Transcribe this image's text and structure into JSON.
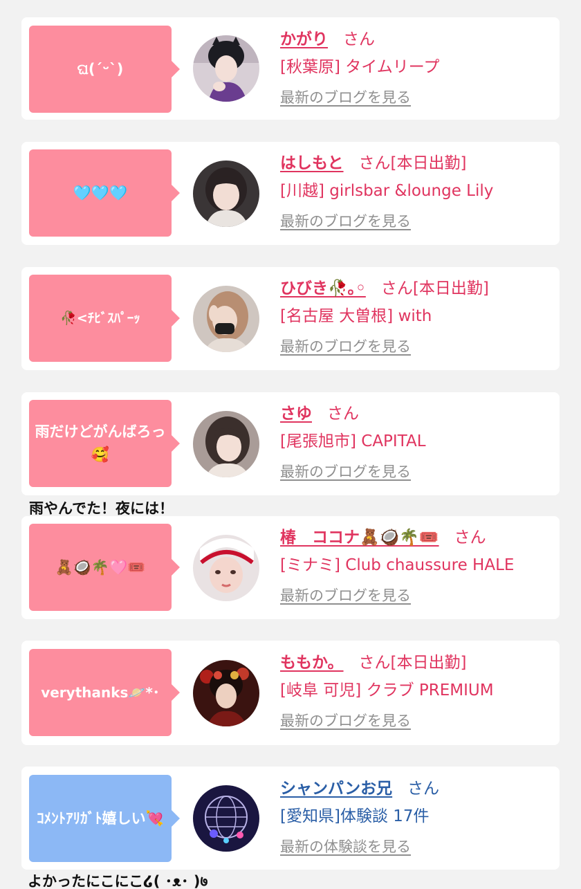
{
  "cards": [
    {
      "bubble": "ଘ(ˊᵕˋ)",
      "name": "かがり",
      "san": "さん",
      "tag": "",
      "shop": "[秋葉原] タイムリープ",
      "link": "最新のブログを見る"
    },
    {
      "bubble": "🩵🩵🩵",
      "name": "はしもと",
      "san": "さん",
      "tag": "[本日出勤]",
      "shop": "[川越] girlsbar &lounge Lily",
      "link": "最新のブログを見る"
    },
    {
      "bubble": "🥀<ﾁﾋﾞｽﾊﾟｰｯ",
      "name": "ひびき🥀｡◦",
      "san": "さん",
      "tag": "[本日出勤]",
      "shop": "[名古屋 大曽根] with",
      "link": "最新のブログを見る"
    },
    {
      "bubble": "雨だけどがんばろっ🥰",
      "name": "さゆ",
      "san": "さん",
      "tag": "",
      "shop": "[尾張旭市] CAPITAL",
      "link": "最新のブログを見る"
    },
    {
      "bubble": "🧸🥥🌴🩷🎟️",
      "name": "椿　ココナ🧸🥥🌴🎟️",
      "san": "さん",
      "tag": "",
      "shop": "[ミナミ] Club chaussure HALE",
      "link": "最新のブログを見る"
    },
    {
      "bubble": "verythanks🪐*･",
      "name": "ももか。",
      "san": "さん",
      "tag": "[本日出勤]",
      "shop": "[岐阜 可児] クラブ PREMIUM",
      "link": "最新のブログを見る"
    },
    {
      "bubble": "ｺﾒﾝﾄｱﾘｶﾞﾄ嬉しい💘",
      "name": "シャンパンお兄",
      "san": "さん",
      "tag": "",
      "shop": "[愛知県]体験談 17件",
      "link": "最新の体験談を見る"
    }
  ],
  "captions": {
    "after_card_4": "雨やんでた！夜には！",
    "after_card_7": "よかったにこにこ໒( ･ᴥ･ )७"
  },
  "colors": {
    "pink_bubble": "#fd8d9e",
    "blue_bubble": "#8cb8f5",
    "pink_text": "#e0345f",
    "blue_text": "#2a5ea6"
  }
}
